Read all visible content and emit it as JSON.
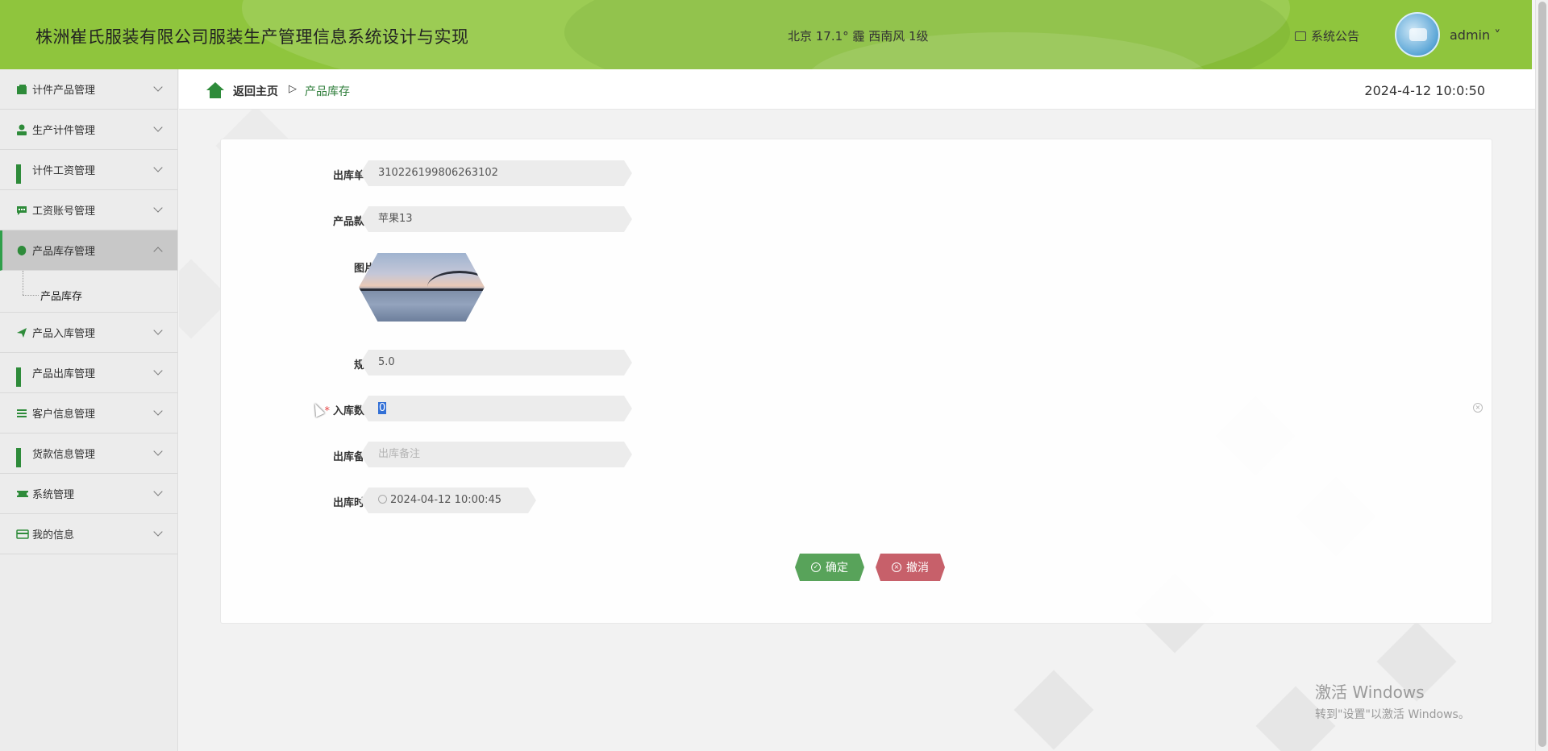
{
  "header": {
    "title": "株洲崔氏服装有限公司服装生产管理信息系统设计与实现",
    "weather": "北京  17.1°  霾  西南风  1级",
    "notice_label": "系统公告",
    "username": "admin ˅"
  },
  "sidebar": {
    "items": [
      {
        "label": "计件产品管理",
        "icon": "wallet-icon"
      },
      {
        "label": "生产计件管理",
        "icon": "user-icon"
      },
      {
        "label": "计件工资管理",
        "icon": "grid-icon"
      },
      {
        "label": "工资账号管理",
        "icon": "chat-icon"
      },
      {
        "label": "产品库存管理",
        "icon": "leaf-icon",
        "active": true
      },
      {
        "label": "产品入库管理",
        "icon": "paper-plane-icon"
      },
      {
        "label": "产品出库管理",
        "icon": "grid-icon"
      },
      {
        "label": "客户信息管理",
        "icon": "list-icon"
      },
      {
        "label": "货款信息管理",
        "icon": "grid-icon"
      },
      {
        "label": "系统管理",
        "icon": "ticket-icon"
      },
      {
        "label": "我的信息",
        "icon": "card-icon"
      }
    ],
    "submenu": {
      "label": "产品库存"
    }
  },
  "breadcrumb": {
    "home": "返回主页",
    "separator": "▷",
    "current": "产品库存"
  },
  "clock": "2024-4-12 10:0:50",
  "form": {
    "order_no": {
      "label": "出库单号",
      "value": "310226199806263102"
    },
    "product_no": {
      "label": "产品款号",
      "value": "苹果13"
    },
    "image": {
      "label": "图片"
    },
    "spec": {
      "label": "规格",
      "value": "5.0"
    },
    "quantity": {
      "label": "入库数量",
      "required": "*",
      "value": "0"
    },
    "remark": {
      "label": "出库备注",
      "placeholder": "出库备注"
    },
    "time": {
      "label": "出库时间",
      "value": "2024-04-12 10:00:45"
    }
  },
  "buttons": {
    "confirm": "确定",
    "cancel": "撤消"
  },
  "watermark": {
    "line1": "激活 Windows",
    "line2": "转到\"设置\"以激活 Windows。"
  },
  "colors": {
    "header": "#8fc53d",
    "accent": "#2e8b3a",
    "confirm": "#58a35a",
    "cancel": "#c7606a"
  }
}
